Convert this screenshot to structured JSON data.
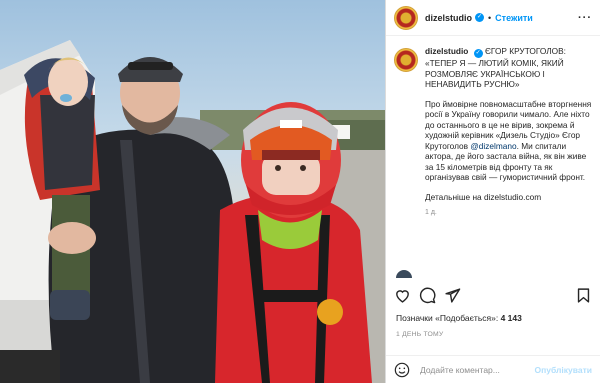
{
  "post": {
    "username": "dizelstudio",
    "follow_label": "Стежити",
    "header_separator": "•",
    "caption": {
      "title": "ЄГОР КРУТОГОЛОВ: «ТЕПЕР Я — ЛЮТИЙ КОМІК, ЯКИЙ РОЗМОВЛЯЄ УКРАЇНСЬКОЮ І НЕНАВИДИТЬ РУСНЮ»",
      "p1_before": "Про ймовірне повномасштабне вторгнення росії в Україну говорили чимало. Але ніхто до останнього в це не вірив, зокрема й художній керівник «Дизель Студіо» Єгор Крутоголов ",
      "mention": "@dizelmano",
      "p1_after": ". Ми спитали актора, де його застала війна, як він живе за 15 кілометрів від фронту та як організував свій — гумористичний фронт.",
      "p2": "Детальніше на dizelstudio.com",
      "time": "1 д."
    },
    "likes_label": "Позначки «Подобається»:",
    "likes_count": "4 143",
    "post_time": "1 ДЕНЬ ТОМУ",
    "comment_placeholder": "Додайте коментар...",
    "publish_label": "Опублікувати"
  },
  "colors": {
    "link": "#0095f6",
    "mention": "#00376b",
    "muted": "#8e8e8e"
  },
  "icons": [
    "verified-icon",
    "more-icon",
    "heart-icon",
    "comment-icon",
    "share-icon",
    "bookmark-icon",
    "emoji-icon"
  ]
}
